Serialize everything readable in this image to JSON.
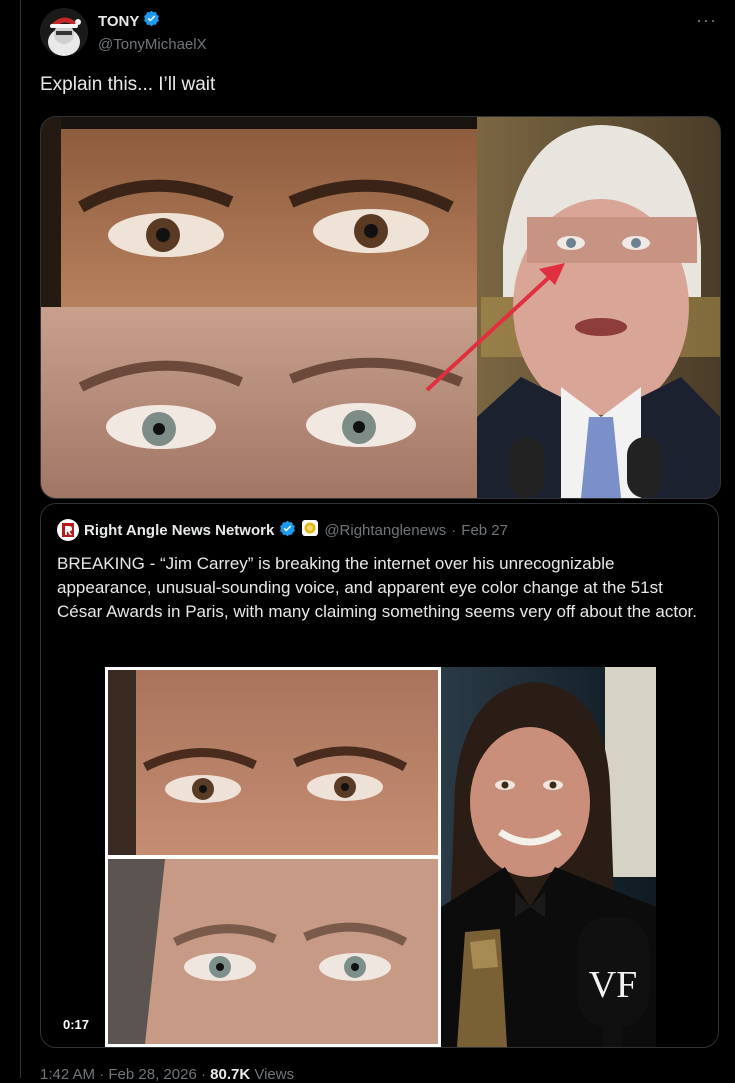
{
  "post": {
    "display_name": "TONY",
    "handle": "@TonyMichaelX",
    "more_glyph": "···",
    "text": "Explain this... I’ll wait"
  },
  "quote": {
    "display_name": "Right Angle News Network",
    "handle": "@Rightanglenews",
    "separator": "·",
    "date": "Feb 27",
    "text": "BREAKING - “Jim Carrey” is breaking the internet over his unrecognizable appearance, unusual-sounding voice, and apparent eye color change at the 51st César Awards in Paris, with many claiming something seems very off about the actor.",
    "video_time": "0:17",
    "watermark": "VF"
  },
  "footer": {
    "time": "1:42 AM",
    "dot1": "·",
    "date": "Feb 28, 2026",
    "dot2": "·",
    "views": "80.7K",
    "views_label": "Views"
  },
  "colors": {
    "background": "#000000",
    "text": "#e7e9ea",
    "muted": "#71767b",
    "border": "#2f3336",
    "verified": "#1d9bf0",
    "annotation_arrow": "#e0303f"
  }
}
